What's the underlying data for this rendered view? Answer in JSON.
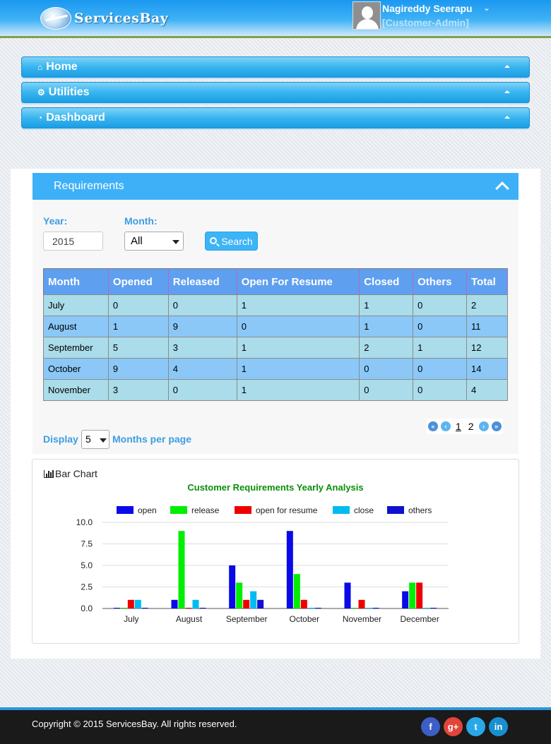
{
  "header": {
    "brand": "ServicesBay",
    "user_name": "Nagireddy Seerapu",
    "user_role": "[Customer-Admin]"
  },
  "nav": [
    {
      "label": "Home",
      "icon": "home-icon"
    },
    {
      "label": "Utilities",
      "icon": "cogs-icon"
    },
    {
      "label": "Dashboard",
      "icon": "dashboard-icon"
    }
  ],
  "requirements": {
    "title": "Requirements",
    "year_label": "Year:",
    "year_value": "2015",
    "month_label": "Month:",
    "month_value": "All",
    "search_label": "Search",
    "table": {
      "columns": [
        "Month",
        "Opened",
        "Released",
        "Open For Resume",
        "Closed",
        "Others",
        "Total"
      ],
      "rows": [
        [
          "July",
          "0",
          "0",
          "1",
          "1",
          "0",
          "2"
        ],
        [
          "August",
          "1",
          "9",
          "0",
          "1",
          "0",
          "11"
        ],
        [
          "September",
          "5",
          "3",
          "1",
          "2",
          "1",
          "12"
        ],
        [
          "October",
          "9",
          "4",
          "1",
          "0",
          "0",
          "14"
        ],
        [
          "November",
          "3",
          "0",
          "1",
          "0",
          "0",
          "4"
        ]
      ]
    },
    "display_label": "Display",
    "display_value": "5",
    "per_page_label": "Months per page",
    "pager": {
      "pages": [
        "1",
        "2"
      ],
      "current": "1"
    }
  },
  "chart_section": {
    "heading": "Bar Chart"
  },
  "chart_data": {
    "type": "bar",
    "title": "Customer Requirements Yearly Analysis",
    "categories": [
      "July",
      "August",
      "September",
      "October",
      "November",
      "December"
    ],
    "series": [
      {
        "name": "open",
        "color": "#0a0ae8",
        "values": [
          0,
          1,
          5,
          9,
          3,
          2
        ]
      },
      {
        "name": "release",
        "color": "#00ee00",
        "values": [
          0,
          9,
          3,
          4,
          0,
          3
        ]
      },
      {
        "name": "open for resume",
        "color": "#ee0000",
        "values": [
          1,
          0,
          1,
          1,
          1,
          3
        ]
      },
      {
        "name": "close",
        "color": "#00bbf0",
        "values": [
          1,
          1,
          2,
          0,
          0,
          0
        ]
      },
      {
        "name": "others",
        "color": "#1010d0",
        "values": [
          0,
          0,
          1,
          0,
          0,
          0
        ]
      }
    ],
    "yticks": [
      "0.0",
      "2.5",
      "5.0",
      "7.5",
      "10.0"
    ],
    "ylim": [
      0,
      10
    ],
    "grid": true,
    "legend": "top"
  },
  "footer": {
    "copyright": "Copyright © 2015 ServicesBay. All rights reserved.",
    "social": [
      {
        "label": "f",
        "icon": "facebook-icon",
        "color": "#3b5ec7"
      },
      {
        "label": "g+",
        "icon": "google-plus-icon",
        "color": "#e2443a"
      },
      {
        "label": "t",
        "icon": "twitter-icon",
        "color": "#28a8e8"
      },
      {
        "label": "in",
        "icon": "linkedin-icon",
        "color": "#1a8fd0"
      }
    ]
  }
}
